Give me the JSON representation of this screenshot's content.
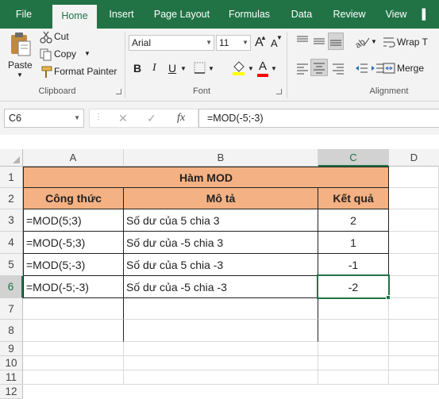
{
  "ribbon_tabs": [
    "File",
    "Home",
    "Insert",
    "Page Layout",
    "Formulas",
    "Data",
    "Review",
    "View"
  ],
  "active_tab": "Home",
  "clipboard": {
    "paste_label": "Paste",
    "cut_label": "Cut",
    "copy_label": "Copy",
    "format_painter_label": "Format Painter",
    "group_label": "Clipboard"
  },
  "font": {
    "font_name": "Arial",
    "font_size": "11",
    "group_label": "Font",
    "bold": "B",
    "italic": "I",
    "underline": "U",
    "grow": "A",
    "shrink": "A",
    "color_letter": "A"
  },
  "alignment": {
    "wrap_label": "Wrap T",
    "merge_label": "Merge",
    "group_label": "Alignment"
  },
  "formula_bar": {
    "name_box": "C6",
    "cancel": "✕",
    "enter": "✓",
    "fx": "fx",
    "formula": "=MOD(-5;-3)"
  },
  "columns": [
    "A",
    "B",
    "C",
    "D"
  ],
  "selected_column": "C",
  "rows": [
    "1",
    "2",
    "3",
    "4",
    "5",
    "6",
    "7",
    "8",
    "9",
    "10",
    "11",
    "12"
  ],
  "selected_row": "6",
  "sheet": {
    "title": "Hàm MOD",
    "headers": [
      "Công thức",
      "Mô tả",
      "Kết quả"
    ],
    "data": [
      [
        "=MOD(5;3)",
        "Số dư của 5 chia 3",
        "2"
      ],
      [
        "=MOD(-5;3)",
        "Số dư của -5 chia 3",
        "1"
      ],
      [
        "=MOD(5;-3)",
        "Số dư của 5 chia -3",
        "-1"
      ],
      [
        "=MOD(-5;-3)",
        "Số dư của -5 chia -3",
        "-2"
      ]
    ]
  },
  "colors": {
    "excel_green": "#217346",
    "header_fill": "#f4b183"
  }
}
